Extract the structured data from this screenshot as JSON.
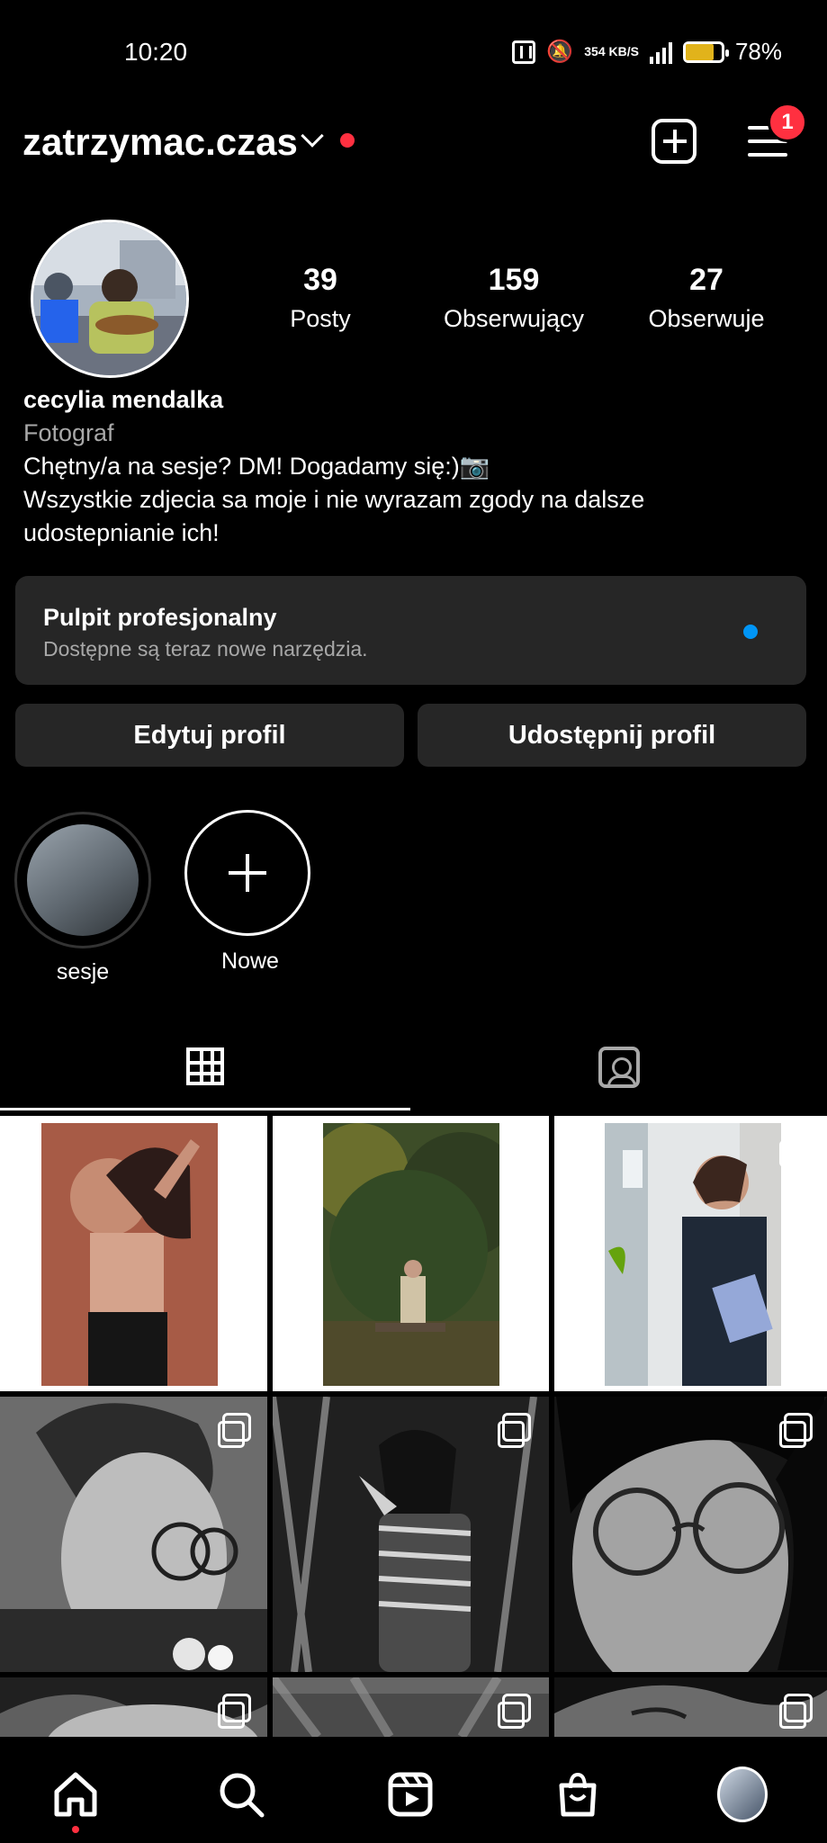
{
  "status": {
    "time": "10:20",
    "speed": "354\nKB/S",
    "battery": "78%",
    "battery_level": 0.78,
    "icons": [
      "nfc-icon",
      "mute-icon",
      "lte-icon",
      "signal-icon",
      "battery-icon"
    ]
  },
  "header": {
    "username": "zatrzymac.czas",
    "notification_badge": "1",
    "icons": [
      "chevron-down-icon",
      "create-post-icon",
      "menu-icon"
    ]
  },
  "profile": {
    "stats": [
      {
        "value": "39",
        "label": "Posty"
      },
      {
        "value": "159",
        "label": "Obserwujący"
      },
      {
        "value": "27",
        "label": "Obserwuje"
      }
    ],
    "name": "cecylia mendalka",
    "category": "Fotograf",
    "bio_line1": "Chętny/a na sesje? DM! Dogadamy się:)📷",
    "bio_line2": "Wszystkie zdjecia sa moje i nie wyrazam zgody na dalsze udostepnianie ich!"
  },
  "professional_dashboard": {
    "title": "Pulpit profesjonalny",
    "subtitle": "Dostępne są teraz nowe narzędzia."
  },
  "buttons": {
    "edit": "Edytuj profil",
    "share": "Udostępnij profil"
  },
  "highlights": [
    {
      "label": "sesje"
    },
    {
      "label": "Nowe"
    }
  ],
  "tabs": [
    "grid-icon",
    "tagged-icon"
  ],
  "grid_posts": [
    {
      "type": "portrait"
    },
    {
      "type": "portrait"
    },
    {
      "type": "portrait-multi"
    },
    {
      "type": "bw-multi"
    },
    {
      "type": "bw-multi"
    },
    {
      "type": "bw-multi"
    },
    {
      "type": "bw-multi"
    },
    {
      "type": "bw-multi"
    },
    {
      "type": "bw-multi"
    }
  ],
  "bottom_nav": [
    "home-icon",
    "search-icon",
    "reels-icon",
    "shop-icon",
    "profile-avatar"
  ],
  "colors": {
    "background": "#000000",
    "accent": "#0095f6",
    "notification": "#ff3040",
    "card": "#262626"
  }
}
